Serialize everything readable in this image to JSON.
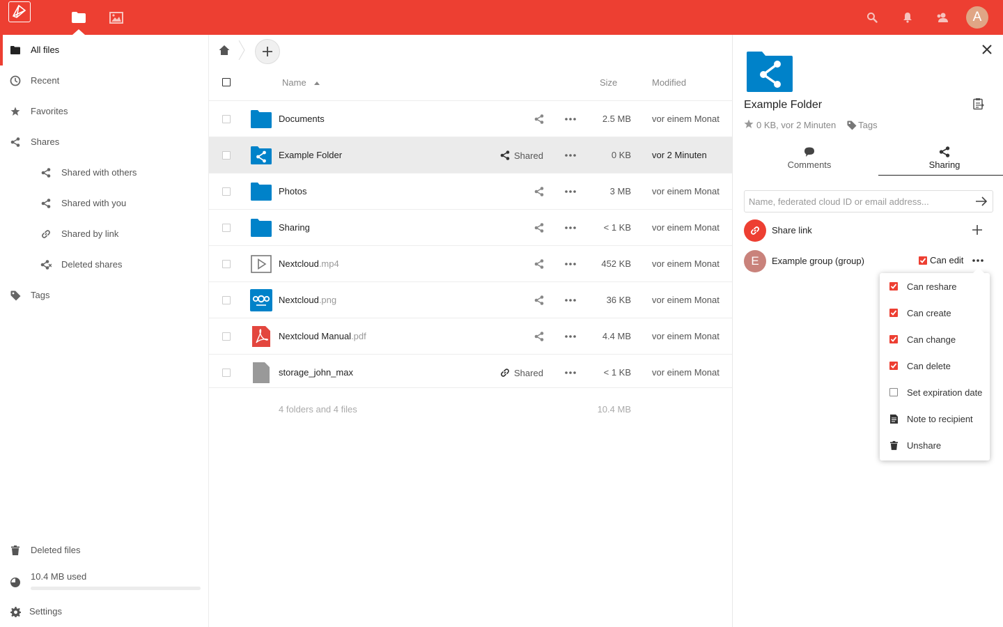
{
  "header": {
    "avatar_letter": "A",
    "brand_color": "#ed3f32"
  },
  "nav": {
    "items": [
      {
        "label": "All files",
        "icon": "folder-icon",
        "active": true
      },
      {
        "label": "Recent",
        "icon": "clock-icon"
      },
      {
        "label": "Favorites",
        "icon": "star-icon"
      },
      {
        "label": "Shares",
        "icon": "share-icon"
      },
      {
        "label": "Shared with others",
        "icon": "share-icon",
        "sub": true
      },
      {
        "label": "Shared with you",
        "icon": "share-icon",
        "sub": true
      },
      {
        "label": "Shared by link",
        "icon": "link-icon",
        "sub": true
      },
      {
        "label": "Deleted shares",
        "icon": "deleted-share-icon",
        "sub": true
      },
      {
        "label": "Tags",
        "icon": "tag-icon"
      }
    ],
    "deleted_files": "Deleted files",
    "quota_text": "10.4 MB used",
    "quota_fraction": 0.0,
    "settings": "Settings"
  },
  "files": {
    "columns": {
      "name": "Name",
      "size": "Size",
      "modified": "Modified"
    },
    "rows": [
      {
        "name": "Documents",
        "ext": "",
        "type": "folder",
        "shared": false,
        "size": "2.5 MB",
        "modified": "vor einem Monat"
      },
      {
        "name": "Example Folder",
        "ext": "",
        "type": "shared-folder",
        "shared": true,
        "shared_label": "Shared",
        "size": "0 KB",
        "modified": "vor 2 Minuten",
        "selected": true
      },
      {
        "name": "Photos",
        "ext": "",
        "type": "folder",
        "shared": false,
        "size": "3 MB",
        "modified": "vor einem Monat"
      },
      {
        "name": "Sharing",
        "ext": "",
        "type": "folder",
        "shared": false,
        "size": "< 1 KB",
        "modified": "vor einem Monat"
      },
      {
        "name": "Nextcloud",
        "ext": ".mp4",
        "type": "video",
        "shared": false,
        "size": "452 KB",
        "modified": "vor einem Monat"
      },
      {
        "name": "Nextcloud",
        "ext": ".png",
        "type": "image",
        "shared": false,
        "size": "36 KB",
        "modified": "vor einem Monat"
      },
      {
        "name": "Nextcloud Manual",
        "ext": ".pdf",
        "type": "pdf",
        "shared": false,
        "size": "4.4 MB",
        "modified": "vor einem Monat"
      },
      {
        "name": "storage_john_max",
        "ext": "",
        "type": "file",
        "shared": true,
        "shared_label": "Shared",
        "share_kind": "link",
        "size": "< 1 KB",
        "modified": "vor einem Monat"
      }
    ],
    "summary": {
      "text": "4 folders and 4 files",
      "size": "10.4 MB"
    }
  },
  "sidebar": {
    "title": "Example Folder",
    "meta": "0 KB, vor 2 Minuten",
    "tags_label": "Tags",
    "tabs": [
      {
        "label": "Comments",
        "icon": "comment-icon"
      },
      {
        "label": "Sharing",
        "icon": "share-icon",
        "active": true
      }
    ],
    "share_input_placeholder": "Name, federated cloud ID or email address...",
    "share_link_label": "Share link",
    "group_avatar_letter": "E",
    "group_label": "Example group (group)",
    "can_edit_label": "Can edit",
    "can_edit_checked": true,
    "menu": [
      {
        "label": "Can reshare",
        "kind": "checkbox",
        "checked": true
      },
      {
        "label": "Can create",
        "kind": "checkbox",
        "checked": true
      },
      {
        "label": "Can change",
        "kind": "checkbox",
        "checked": true
      },
      {
        "label": "Can delete",
        "kind": "checkbox",
        "checked": true
      },
      {
        "label": "Set expiration date",
        "kind": "checkbox",
        "checked": false
      },
      {
        "label": "Note to recipient",
        "kind": "icon",
        "icon": "note-icon"
      },
      {
        "label": "Unshare",
        "kind": "icon",
        "icon": "trash-icon"
      }
    ]
  }
}
